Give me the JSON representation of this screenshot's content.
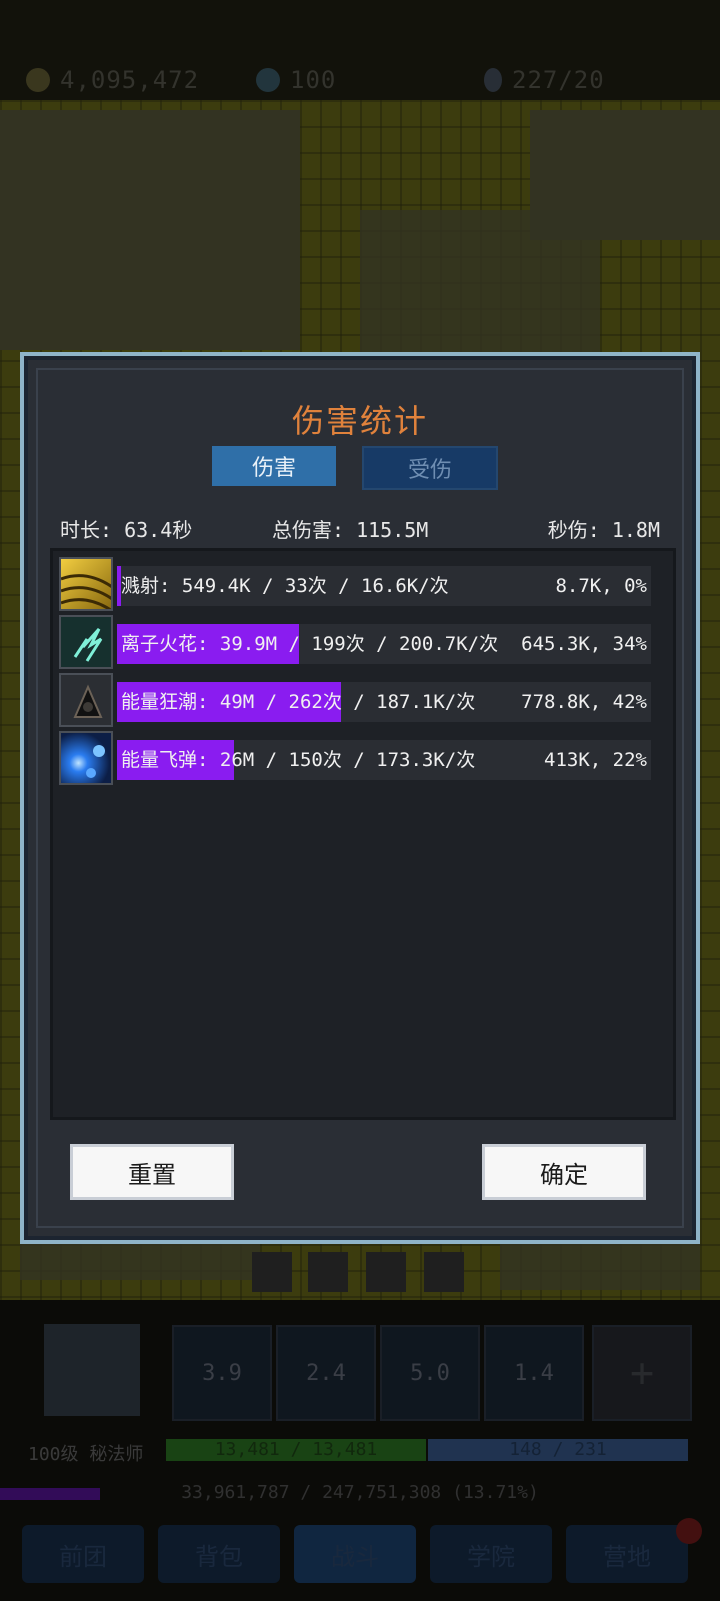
{
  "resources": {
    "gold": "4,095,472",
    "gems": "100",
    "crystals": "227/20"
  },
  "dialog": {
    "title": "伤害统计",
    "tabs": {
      "damage": "伤害",
      "taken": "受伤"
    },
    "stats": {
      "duration": "时长: 63.4秒",
      "total": "总伤害: 115.5M",
      "dps": "秒伤: 1.8M"
    },
    "rows": [
      {
        "text": "溅射: 549.4K / 33次 / 16.6K/次",
        "right": "8.7K, 0%",
        "share": 0.005
      },
      {
        "text": "离子火花: 39.9M / 199次 / 200.7K/次",
        "right": "645.3K, 34%",
        "share": 0.34
      },
      {
        "text": "能量狂潮: 49M / 262次 / 187.1K/次",
        "right": "778.8K, 42%",
        "share": 0.42
      },
      {
        "text": "能量飞弹: 26M / 150次 / 173.3K/次",
        "right": "413K, 22%",
        "share": 0.22
      }
    ],
    "buttons": {
      "reset": "重置",
      "ok": "确定"
    }
  },
  "hud": {
    "skills": [
      "3.9",
      "2.4",
      "5.0",
      "1.4"
    ],
    "player": "100级 秘法师",
    "hp": "13,481 / 13,481",
    "mp": "148 / 231",
    "exp": "33,961,787 / 247,751,308 (13.71%)",
    "nav": [
      "前团",
      "背包",
      "战斗",
      "学院",
      "营地"
    ]
  },
  "colors": {
    "accent_title": "#e0823c",
    "bar": "#8a1cf0",
    "frame": "#8fb4c8"
  }
}
